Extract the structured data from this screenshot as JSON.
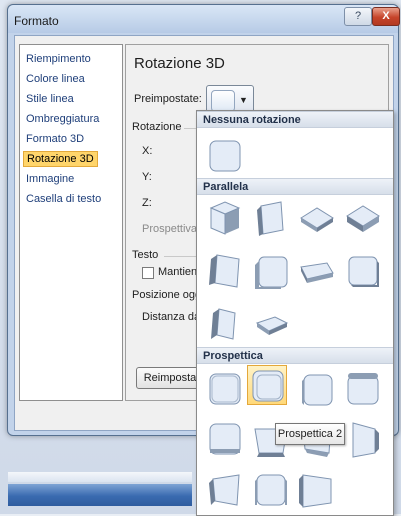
{
  "dialog": {
    "title": "Formato",
    "help_glyph": "?",
    "close_glyph": "X"
  },
  "nav": {
    "items": [
      {
        "label": "Riempimento"
      },
      {
        "label": "Colore linea"
      },
      {
        "label": "Stile linea"
      },
      {
        "label": "Ombreggiatura"
      },
      {
        "label": "Formato 3D"
      },
      {
        "label": "Rotazione 3D",
        "active": true
      },
      {
        "label": "Immagine"
      },
      {
        "label": "Casella di testo"
      }
    ]
  },
  "panel": {
    "title": "Rotazione 3D",
    "preset_label": "Preimpostate:",
    "rotation_group": "Rotazione",
    "x_label": "X:",
    "y_label": "Y:",
    "z_label": "Z:",
    "perspective_label": "Prospettiva:",
    "text_group": "Testo",
    "keep_text_flat": "Mantieni t",
    "object_position_group": "Posizione oggett",
    "distance_label": "Distanza dalla",
    "reset_button": "Reimposta",
    "preset_arrow": "▼"
  },
  "gallery": {
    "sections": [
      {
        "title": "Nessuna rotazione"
      },
      {
        "title": "Parallela"
      },
      {
        "title": "Prospettica"
      }
    ],
    "highlighted_item": "Prospettica 2",
    "tooltip": "Prospettica 2"
  },
  "colors": {
    "accent_active": "#ffd56b",
    "tooltip_bg": "#ffffff"
  }
}
